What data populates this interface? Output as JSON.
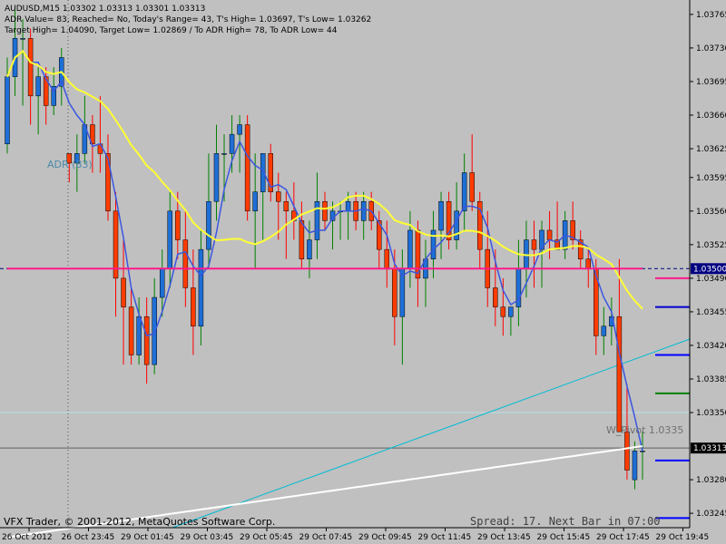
{
  "header": {
    "symbol_line": "AUDUSD,M15  1.03302 1.03313 1.03301 1.03313",
    "adr_line": "ADR Value= 83, Reached= No, Today's Range= 43, T's High= 1.03697, T's Low= 1.03262",
    "target_line": "Target High= 1.04090, Target Low= 1.02869 / To ADR High= 78, To ADR Low= 44"
  },
  "footer": {
    "copyright": "VFX Trader, © 2001-2012, MetaQuotes Software Corp.",
    "status": "Spread: 17. Next Bar in 07:00"
  },
  "labels": {
    "adr": "ADR (83)",
    "pivot": "W_Pivot 1.0335"
  },
  "colors": {
    "background": "#c0c0c0",
    "bull": "#1e6fd6",
    "bear": "#ff3c00",
    "ma_fast": "#3a56e0",
    "ma_yellow": "#ffff33",
    "ma_magenta": "#ff1a8c",
    "ma_white": "#ffffff",
    "trendline": "#00bcd4"
  },
  "chart_data": {
    "type": "candlestick",
    "symbol": "AUDUSD",
    "timeframe": "M15",
    "ylim": [
      1.0323,
      1.0378
    ],
    "price_ticks": [
      "1.03765",
      "1.03730",
      "1.03695",
      "1.03660",
      "1.03625",
      "1.03595",
      "1.03560",
      "1.03525",
      "1.03490",
      "1.03455",
      "1.03420",
      "1.03385",
      "1.03350",
      "1.03280",
      "1.03245"
    ],
    "current_price": "1.03313",
    "level_label": "1.03500",
    "time_labels": [
      "26 Oct 2012",
      "26 Oct 23:45",
      "29 Oct 01:45",
      "29 Oct 03:45",
      "29 Oct 05:45",
      "29 Oct 07:45",
      "29 Oct 09:45",
      "29 Oct 11:45",
      "29 Oct 13:45",
      "29 Oct 15:45",
      "29 Oct 17:45",
      "29 Oct 19:45"
    ],
    "candles": [
      [
        1.0363,
        1.0372,
        1.0362,
        1.037
      ],
      [
        1.037,
        1.0377,
        1.0368,
        1.0374
      ],
      [
        1.0374,
        1.0376,
        1.0367,
        1.0374
      ],
      [
        1.0374,
        1.0375,
        1.0365,
        1.0368
      ],
      [
        1.0368,
        1.0371,
        1.0364,
        1.037
      ],
      [
        1.037,
        1.0371,
        1.0365,
        1.0367
      ],
      [
        1.0367,
        1.0371,
        1.0366,
        1.0369
      ],
      [
        1.0369,
        1.0373,
        1.0367,
        1.0372
      ],
      [
        1.0362,
        1.0362,
        1.0359,
        1.0361
      ],
      [
        1.0361,
        1.0364,
        1.0358,
        1.0362
      ],
      [
        1.0362,
        1.0368,
        1.0361,
        1.0365
      ],
      [
        1.0365,
        1.0366,
        1.036,
        1.0363
      ],
      [
        1.0363,
        1.0368,
        1.036,
        1.0362
      ],
      [
        1.0362,
        1.0364,
        1.0355,
        1.0356
      ],
      [
        1.0356,
        1.0358,
        1.0345,
        1.0349
      ],
      [
        1.0349,
        1.0353,
        1.034,
        1.0346
      ],
      [
        1.0346,
        1.0348,
        1.034,
        1.0341
      ],
      [
        1.0341,
        1.0347,
        1.034,
        1.0345
      ],
      [
        1.0345,
        1.0347,
        1.0338,
        1.034
      ],
      [
        1.034,
        1.0349,
        1.0339,
        1.0347
      ],
      [
        1.0347,
        1.0352,
        1.0345,
        1.035
      ],
      [
        1.035,
        1.0358,
        1.0348,
        1.0356
      ],
      [
        1.0356,
        1.0358,
        1.0351,
        1.0353
      ],
      [
        1.0353,
        1.0356,
        1.0346,
        1.0348
      ],
      [
        1.0348,
        1.0352,
        1.0341,
        1.0344
      ],
      [
        1.0344,
        1.0354,
        1.0342,
        1.0352
      ],
      [
        1.0352,
        1.0362,
        1.035,
        1.0357
      ],
      [
        1.0357,
        1.0365,
        1.0355,
        1.0362
      ],
      [
        1.0362,
        1.0364,
        1.0357,
        1.0362
      ],
      [
        1.0362,
        1.0366,
        1.036,
        1.0364
      ],
      [
        1.0364,
        1.0366,
        1.036,
        1.0365
      ],
      [
        1.0365,
        1.0366,
        1.0355,
        1.0356
      ],
      [
        1.0356,
        1.0362,
        1.035,
        1.0358
      ],
      [
        1.0358,
        1.0361,
        1.0353,
        1.0362
      ],
      [
        1.0362,
        1.0363,
        1.0357,
        1.0358
      ],
      [
        1.0358,
        1.036,
        1.0353,
        1.0357
      ],
      [
        1.0357,
        1.0358,
        1.0351,
        1.0356
      ],
      [
        1.0356,
        1.0359,
        1.0353,
        1.0355
      ],
      [
        1.0355,
        1.0357,
        1.035,
        1.0351
      ],
      [
        1.0351,
        1.0355,
        1.0349,
        1.0353
      ],
      [
        1.0353,
        1.036,
        1.0351,
        1.0357
      ],
      [
        1.0357,
        1.0358,
        1.0354,
        1.0355
      ],
      [
        1.0355,
        1.0357,
        1.0352,
        1.0356
      ],
      [
        1.0356,
        1.0357,
        1.0353,
        1.0356
      ],
      [
        1.0356,
        1.0358,
        1.0353,
        1.0357
      ],
      [
        1.0357,
        1.0358,
        1.0354,
        1.0355
      ],
      [
        1.0355,
        1.0358,
        1.0353,
        1.0357
      ],
      [
        1.0357,
        1.0358,
        1.0354,
        1.0355
      ],
      [
        1.0355,
        1.0356,
        1.035,
        1.0352
      ],
      [
        1.0352,
        1.0355,
        1.0348,
        1.035
      ],
      [
        1.035,
        1.0352,
        1.0342,
        1.0345
      ],
      [
        1.0345,
        1.0352,
        1.034,
        1.035
      ],
      [
        1.035,
        1.0356,
        1.0348,
        1.0354
      ],
      [
        1.0354,
        1.0355,
        1.0346,
        1.0349
      ],
      [
        1.0349,
        1.0353,
        1.0346,
        1.0351
      ],
      [
        1.0351,
        1.0356,
        1.0349,
        1.0354
      ],
      [
        1.0354,
        1.0358,
        1.0351,
        1.0357
      ],
      [
        1.0357,
        1.0358,
        1.0352,
        1.0353
      ],
      [
        1.0353,
        1.0359,
        1.0352,
        1.0356
      ],
      [
        1.0356,
        1.0362,
        1.0354,
        1.036
      ],
      [
        1.036,
        1.0364,
        1.0356,
        1.0357
      ],
      [
        1.0357,
        1.0358,
        1.035,
        1.0352
      ],
      [
        1.0352,
        1.0356,
        1.0346,
        1.0348
      ],
      [
        1.0348,
        1.0352,
        1.0344,
        1.0346
      ],
      [
        1.0346,
        1.0349,
        1.0343,
        1.0345
      ],
      [
        1.0345,
        1.0346,
        1.0343,
        1.0346
      ],
      [
        1.0346,
        1.0353,
        1.0344,
        1.035
      ],
      [
        1.035,
        1.0355,
        1.0347,
        1.0353
      ],
      [
        1.0353,
        1.0355,
        1.0348,
        1.0352
      ],
      [
        1.0352,
        1.0355,
        1.0348,
        1.0354
      ],
      [
        1.0354,
        1.0356,
        1.0351,
        1.0353
      ],
      [
        1.0353,
        1.0357,
        1.0352,
        1.0352
      ],
      [
        1.0352,
        1.0356,
        1.0351,
        1.0355
      ],
      [
        1.0355,
        1.0357,
        1.0352,
        1.0353
      ],
      [
        1.0353,
        1.0354,
        1.035,
        1.0351
      ],
      [
        1.0351,
        1.0352,
        1.0348,
        1.035
      ],
      [
        1.035,
        1.0351,
        1.0341,
        1.0343
      ],
      [
        1.0343,
        1.0346,
        1.0341,
        1.0344
      ],
      [
        1.0344,
        1.0347,
        1.0342,
        1.0345
      ],
      [
        1.0345,
        1.0351,
        1.034,
        1.0333
      ],
      [
        1.0333,
        1.0338,
        1.0328,
        1.0329
      ],
      [
        1.0328,
        1.0332,
        1.0327,
        1.0331
      ],
      [
        1.0331,
        1.0333,
        1.0328,
        1.0331
      ]
    ]
  }
}
